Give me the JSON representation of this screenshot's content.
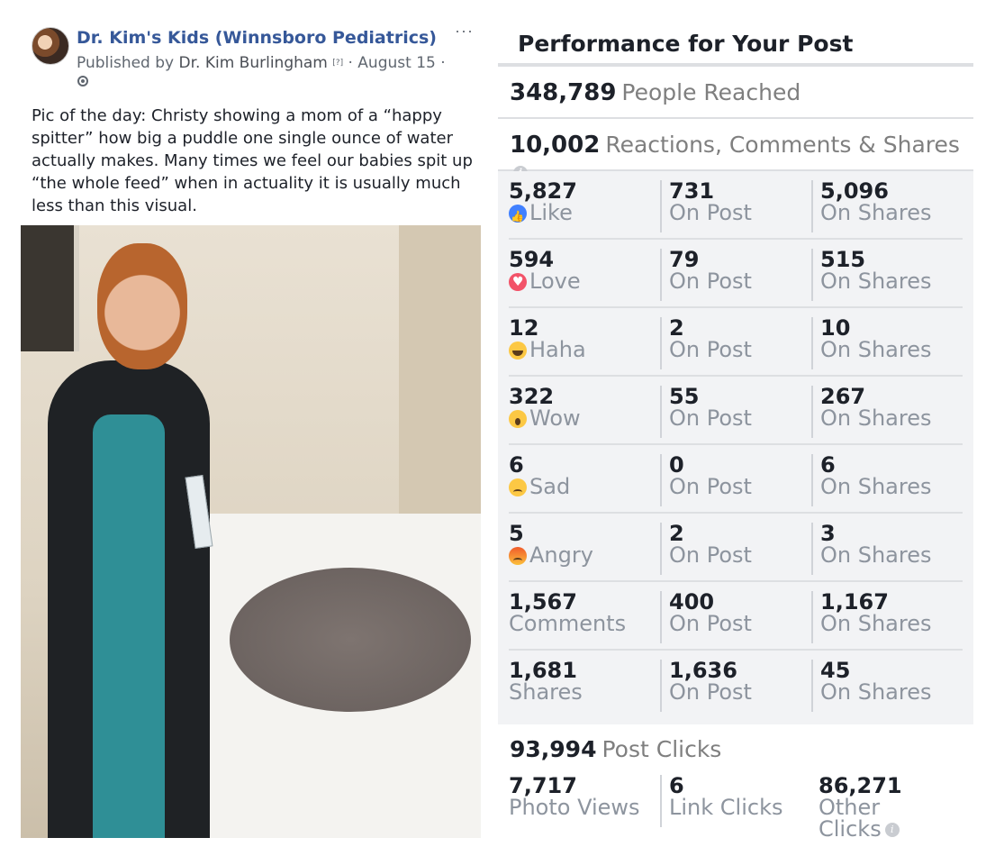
{
  "post": {
    "page_name": "Dr. Kim's Kids (Winnsboro Pediatrics)",
    "published_by": "Published by",
    "author": "Dr. Kim Burlingham",
    "author_hint": "[?]",
    "date": "· August 15 ·",
    "more": "···",
    "text": "Pic of the day: Christy showing a mom of a “happy spitter” how big a puddle one single ounce of water actually makes. Many times we feel our babies spit up “the whole feed” when in actuality it is usually much less than this visual."
  },
  "insights": {
    "title": "Performance for Your Post",
    "reach": {
      "value": "348,789",
      "label": "People Reached"
    },
    "engagement": {
      "value": "10,002",
      "label": "Reactions, Comments & Shares",
      "info": "i"
    },
    "rows": [
      {
        "total": "5,827",
        "label": "Like",
        "icon": "like-icon",
        "on_post": "731",
        "on_post_label": "On Post",
        "on_shares": "5,096",
        "on_shares_label": "On Shares"
      },
      {
        "total": "594",
        "label": "Love",
        "icon": "love-icon",
        "on_post": "79",
        "on_post_label": "On Post",
        "on_shares": "515",
        "on_shares_label": "On Shares"
      },
      {
        "total": "12",
        "label": "Haha",
        "icon": "haha-icon",
        "on_post": "2",
        "on_post_label": "On Post",
        "on_shares": "10",
        "on_shares_label": "On Shares"
      },
      {
        "total": "322",
        "label": "Wow",
        "icon": "wow-icon",
        "on_post": "55",
        "on_post_label": "On Post",
        "on_shares": "267",
        "on_shares_label": "On Shares"
      },
      {
        "total": "6",
        "label": "Sad",
        "icon": "sad-icon",
        "on_post": "0",
        "on_post_label": "On Post",
        "on_shares": "6",
        "on_shares_label": "On Shares"
      },
      {
        "total": "5",
        "label": "Angry",
        "icon": "angry-icon",
        "on_post": "2",
        "on_post_label": "On Post",
        "on_shares": "3",
        "on_shares_label": "On Shares"
      },
      {
        "total": "1,567",
        "label": "Comments",
        "icon": "",
        "on_post": "400",
        "on_post_label": "On Post",
        "on_shares": "1,167",
        "on_shares_label": "On Shares"
      },
      {
        "total": "1,681",
        "label": "Shares",
        "icon": "",
        "on_post": "1,636",
        "on_post_label": "On Post",
        "on_shares": "45",
        "on_shares_label": "On Shares"
      }
    ],
    "clicks": {
      "value": "93,994",
      "label": "Post Clicks",
      "photo_views": "7,717",
      "photo_views_label": "Photo Views",
      "link_clicks": "6",
      "link_clicks_label": "Link Clicks",
      "other_clicks": "86,271",
      "other_clicks_label_1": "Other",
      "other_clicks_label_2": "Clicks",
      "info": "i"
    }
  },
  "colors": {
    "page_link": "#365899",
    "muted": "#8d949e",
    "panel_bg": "#f2f3f5",
    "like": "#4080ff",
    "love": "#f25268",
    "reaction_yellow": "#fcc844"
  }
}
